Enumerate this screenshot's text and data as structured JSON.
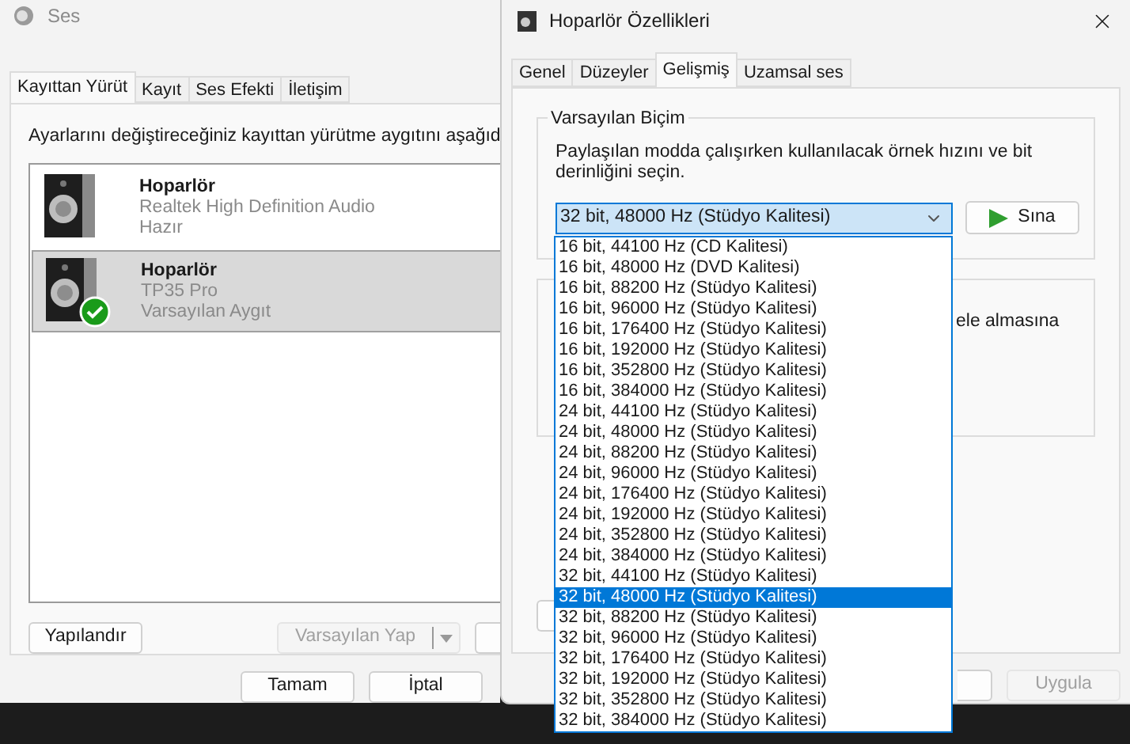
{
  "sound_window": {
    "title": "Ses",
    "tabs": [
      {
        "label": "Kayıttan Yürüt",
        "selected": true
      },
      {
        "label": "Kayıt",
        "selected": false
      },
      {
        "label": "Ses Efekti",
        "selected": false
      },
      {
        "label": "İletişim",
        "selected": false
      }
    ],
    "instruction": "Ayarlarını değiştireceğiniz kayıttan yürütme aygıtını aşağıd",
    "devices": [
      {
        "name": "Hoparlör",
        "description": "Realtek High Definition Audio",
        "status": "Hazır",
        "selected": false,
        "is_default": false
      },
      {
        "name": "Hoparlör",
        "description": "TP35 Pro",
        "status": "Varsayılan Aygıt",
        "selected": true,
        "is_default": true
      }
    ],
    "configure_button": "Yapılandır",
    "set_default_button": {
      "label": "Varsayılan Yap",
      "disabled": true
    },
    "footer_buttons": [
      {
        "label": "Tamam",
        "disabled": false
      },
      {
        "label": "İptal",
        "disabled": false
      }
    ]
  },
  "properties_window": {
    "title": "Hoparlör Özellikleri",
    "tabs": [
      {
        "label": "Genel",
        "selected": false
      },
      {
        "label": "Düzeyler",
        "selected": false
      },
      {
        "label": "Gelişmiş",
        "selected": true
      },
      {
        "label": "Uzamsal ses",
        "selected": false
      }
    ],
    "default_format": {
      "title": "Varsayılan Biçim",
      "description": "Paylaşılan modda çalışırken kullanılacak örnek hızını ve bit derinliğini seçin.",
      "value": "32 bit, 48000 Hz (Stüdyo Kalitesi)",
      "test_button": "Sına"
    },
    "exclusive_text": "ele almasına",
    "format_options": [
      {
        "label": "16 bit, 44100 Hz (CD Kalitesi)",
        "selected": false
      },
      {
        "label": "16 bit, 48000 Hz (DVD Kalitesi)",
        "selected": false
      },
      {
        "label": "16 bit, 88200 Hz (Stüdyo Kalitesi)",
        "selected": false
      },
      {
        "label": "16 bit, 96000 Hz (Stüdyo Kalitesi)",
        "selected": false
      },
      {
        "label": "16 bit, 176400 Hz (Stüdyo Kalitesi)",
        "selected": false
      },
      {
        "label": "16 bit, 192000 Hz (Stüdyo Kalitesi)",
        "selected": false
      },
      {
        "label": "16 bit, 352800 Hz (Stüdyo Kalitesi)",
        "selected": false
      },
      {
        "label": "16 bit, 384000 Hz (Stüdyo Kalitesi)",
        "selected": false
      },
      {
        "label": "24 bit, 44100 Hz (Stüdyo Kalitesi)",
        "selected": false
      },
      {
        "label": "24 bit, 48000 Hz (Stüdyo Kalitesi)",
        "selected": false
      },
      {
        "label": "24 bit, 88200 Hz (Stüdyo Kalitesi)",
        "selected": false
      },
      {
        "label": "24 bit, 96000 Hz (Stüdyo Kalitesi)",
        "selected": false
      },
      {
        "label": "24 bit, 176400 Hz (Stüdyo Kalitesi)",
        "selected": false
      },
      {
        "label": "24 bit, 192000 Hz (Stüdyo Kalitesi)",
        "selected": false
      },
      {
        "label": "24 bit, 352800 Hz (Stüdyo Kalitesi)",
        "selected": false
      },
      {
        "label": "24 bit, 384000 Hz (Stüdyo Kalitesi)",
        "selected": false
      },
      {
        "label": "32 bit, 44100 Hz (Stüdyo Kalitesi)",
        "selected": false
      },
      {
        "label": "32 bit, 48000 Hz (Stüdyo Kalitesi)",
        "selected": true
      },
      {
        "label": "32 bit, 88200 Hz (Stüdyo Kalitesi)",
        "selected": false
      },
      {
        "label": "32 bit, 96000 Hz (Stüdyo Kalitesi)",
        "selected": false
      },
      {
        "label": "32 bit, 176400 Hz (Stüdyo Kalitesi)",
        "selected": false
      },
      {
        "label": "32 bit, 192000 Hz (Stüdyo Kalitesi)",
        "selected": false
      },
      {
        "label": "32 bit, 352800 Hz (Stüdyo Kalitesi)",
        "selected": false
      },
      {
        "label": "32 bit, 384000 Hz (Stüdyo Kalitesi)",
        "selected": false
      }
    ],
    "apply_button": {
      "label": "Uygula",
      "disabled": true
    }
  }
}
